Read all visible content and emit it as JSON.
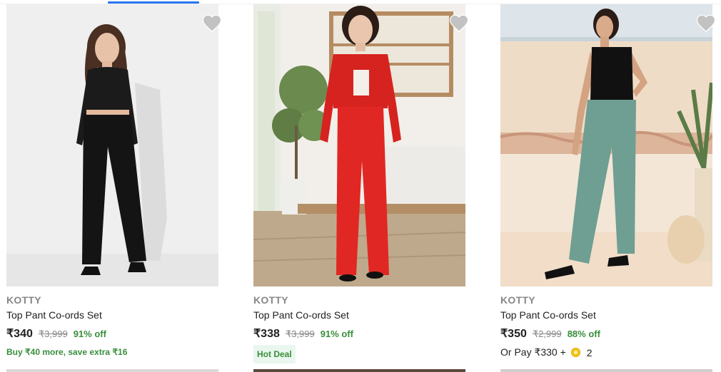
{
  "colors": {
    "accent": "#2874f0",
    "discount_green": "#388e3c",
    "badge_bg": "#e9f7ee",
    "wishlist_heart": "#c2c2c2"
  },
  "products": [
    {
      "brand": "KOTTY",
      "title": "Top Pant Co-ords Set",
      "price": "₹340",
      "mrp": "₹3,999",
      "discount": "91% off",
      "offer": "Buy ₹40 more, save extra ₹16",
      "image_alt": "Black crop top and wide leg pants co-ords set",
      "wishlist_icon": "heart-icon"
    },
    {
      "brand": "KOTTY",
      "title": "Top Pant Co-ords Set",
      "price": "₹338",
      "mrp": "₹3,999",
      "discount": "91% off",
      "badge": "Hot Deal",
      "image_alt": "Red blazer and pants co-ords set",
      "wishlist_icon": "heart-icon"
    },
    {
      "brand": "KOTTY",
      "title": "Top Pant Co-ords Set",
      "price": "₹350",
      "mrp": "₹2,999",
      "discount": "88% off",
      "pay_prefix": "Or Pay ₹330 +",
      "pay_coins": "2",
      "coin_icon": "supercoin-icon",
      "image_alt": "Black top and sage green trousers co-ords set",
      "wishlist_icon": "heart-icon"
    }
  ]
}
